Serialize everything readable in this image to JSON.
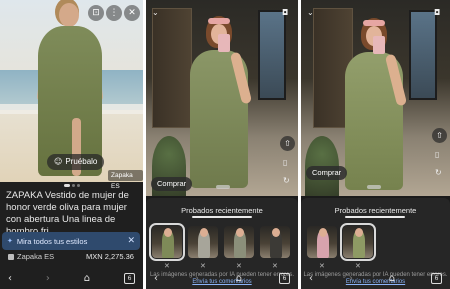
{
  "panel1": {
    "product_title": "ZAPAKA Vestido de mujer de honor verde oliva para mujer con abertura Una linea de hombro fri",
    "try_on_label": "Pruébalo",
    "source_badge": "Zapaka ES",
    "banner_text": "Mira todos tus estilos",
    "merchant": "Zapaka ES",
    "price": "MXN 2,275.36",
    "icons": [
      "bookmark-icon",
      "more-vert-icon",
      "close-icon",
      "sparkle-icon",
      "back-arrow-icon",
      "forward-arrow-icon",
      "home-icon",
      "tabs-icon"
    ],
    "tab_count": "6"
  },
  "panel2": {
    "buy_label": "Comprar",
    "sheet_title": "Probados recientemente",
    "disclaimer": "Las imágenes generadas por IA pueden tener errores.",
    "feedback_link": "Envía tus comentarios",
    "tab_count": "6"
  },
  "panel3": {
    "buy_label": "Comprar",
    "sheet_title": "Probados recientemente",
    "disclaimer": "Las imágenes generadas por IA pueden tener errores.",
    "feedback_link": "Envía tus comentarios",
    "tab_count": "6"
  },
  "colors": {
    "dark_bg": "#1b1b1b",
    "sheet_bg": "#262626",
    "banner_bg": "#2f4a6d",
    "link": "#8ab4f8",
    "dress_olive": "#7f8c5a"
  }
}
